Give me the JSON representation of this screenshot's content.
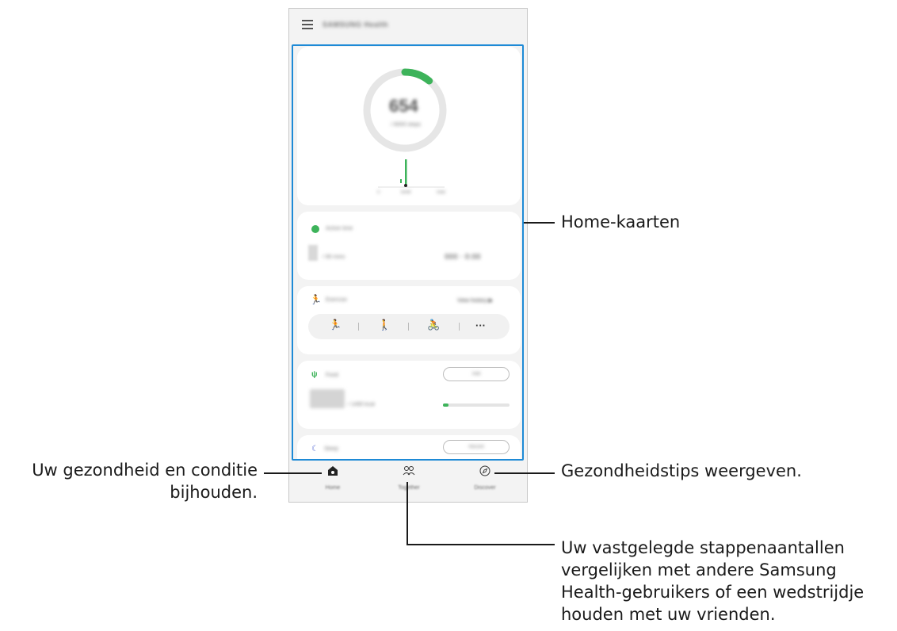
{
  "app": {
    "title": "SAMSUNG Health"
  },
  "steps_card": {
    "count": "654",
    "goal": "/ 6000 steps",
    "progress": 0.11,
    "chart_left": "0",
    "chart_mid": "6AM",
    "chart_right": "now"
  },
  "active_time": {
    "title": "Active time",
    "value": "/ 90 mins",
    "extra": "000 · 0:00"
  },
  "exercise": {
    "title": "Exercise",
    "view_history": "View history ▶",
    "more": "···"
  },
  "food": {
    "title": "Food",
    "button": "Add",
    "value": "/ 1490 kcal",
    "progress": 0.08
  },
  "sleep": {
    "title": "Sleep",
    "button": "Record"
  },
  "nav": {
    "home": "Home",
    "together": "Together",
    "discover": "Discover"
  },
  "callouts": {
    "home_cards": "Home-kaarten",
    "track_line1": "Uw gezondheid en conditie",
    "track_line2": "bijhouden.",
    "tips": "Gezondheidstips weergeven.",
    "compare_line1": "Uw vastgelegde stappenaantallen",
    "compare_line2": "vergelijken met andere Samsung",
    "compare_line3": "Health-gebruikers of een wedstrijdje",
    "compare_line4": "houden met uw vrienden."
  },
  "colors": {
    "accent_green": "#3db35a",
    "highlight_blue": "#1e8ad6",
    "sleep_icon": "#5b6fd6"
  }
}
